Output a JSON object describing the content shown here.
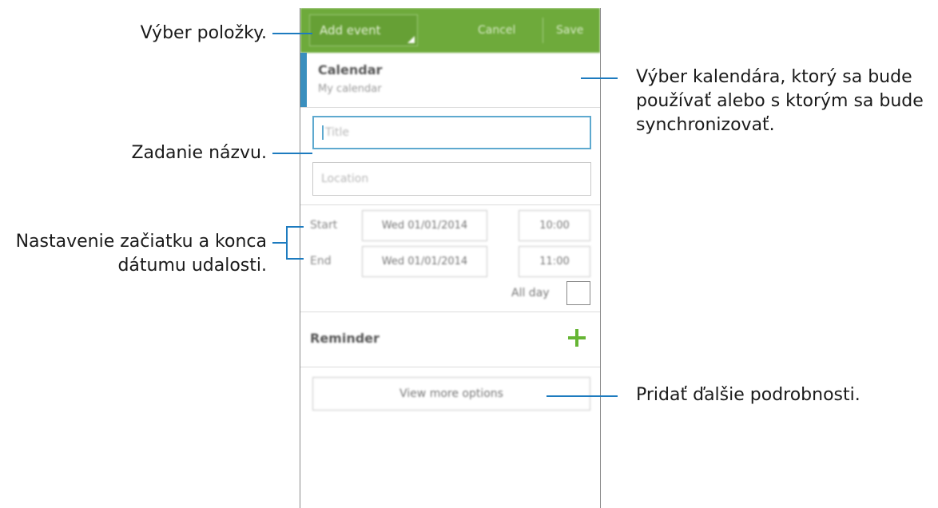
{
  "app": {
    "action_bar": {
      "title": "Add event",
      "cancel_label": "Cancel",
      "save_label": "Save"
    },
    "calendar": {
      "label": "Calendar",
      "value": "My calendar"
    },
    "title_field": {
      "placeholder": "Title"
    },
    "location_field": {
      "placeholder": "Location"
    },
    "start": {
      "label": "Start",
      "date": "Wed 01/01/2014",
      "time": "10:00"
    },
    "end": {
      "label": "End",
      "date": "Wed 01/01/2014",
      "time": "11:00"
    },
    "all_day": {
      "label": "All day",
      "checked": false
    },
    "reminder": {
      "label": "Reminder"
    },
    "more_options_label": "View more options"
  },
  "callouts": {
    "select_item": "Výber položky.",
    "enter_title": "Zadanie názvu.",
    "set_dates_line1": "Nastavenie začiatku a konca",
    "set_dates_line2": "dátumu udalosti.",
    "select_calendar_line1": "Výber kalendára, ktorý sa bude",
    "select_calendar_line2": "používať alebo s ktorým sa bude",
    "select_calendar_line3": "synchronizovať.",
    "add_details": "Pridať ďalšie podrobnosti."
  },
  "colors": {
    "action_bar": "#6eaa3b",
    "callout_line": "#1d7bbf",
    "calendar_accent": "#3a8fbe",
    "plus": "#66b534"
  }
}
